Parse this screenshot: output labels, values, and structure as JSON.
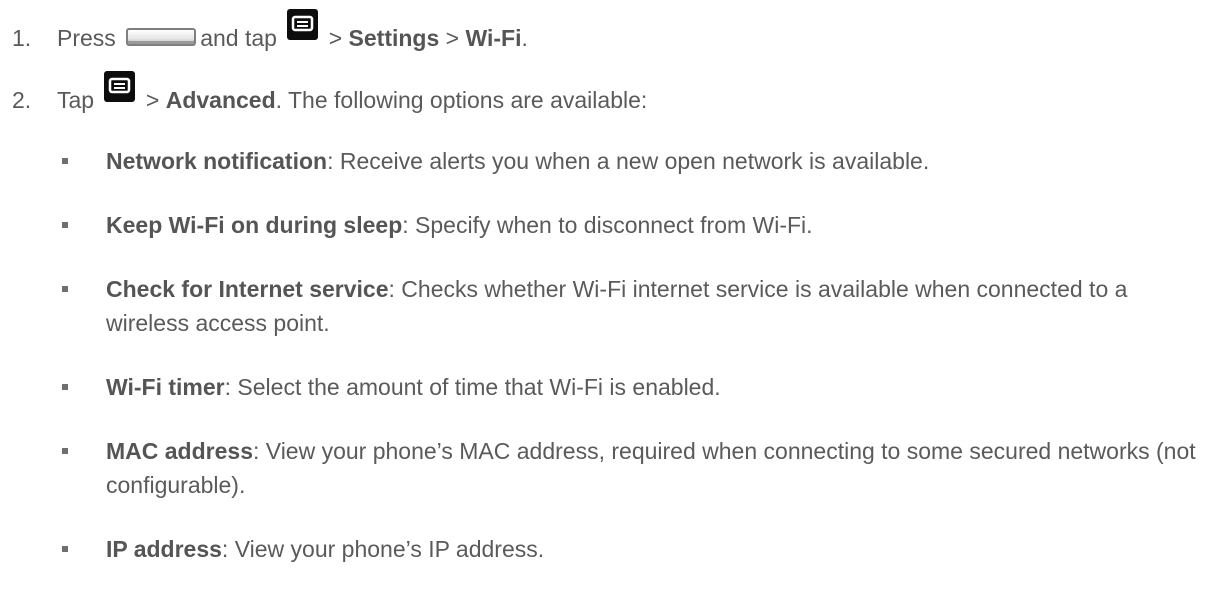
{
  "steps": [
    {
      "number": "1.",
      "prefix": "Press",
      "mid": "and tap",
      "sep1": ">",
      "item1": "Settings",
      "sep2": ">",
      "item2": "Wi-Fi",
      "end": "."
    },
    {
      "number": "2.",
      "prefix": "Tap",
      "sep1": ">",
      "item1": "Advanced",
      "rest": ". The following options are available:"
    }
  ],
  "options": [
    {
      "term": "Network notification",
      "desc": ": Receive alerts you when a new open network is available."
    },
    {
      "term": "Keep Wi-Fi on during sleep",
      "desc": ": Specify when to disconnect from Wi-Fi."
    },
    {
      "term": "Check for Internet service",
      "desc": ": Checks whether Wi-Fi internet service is available when connected to a wireless access point."
    },
    {
      "term": "Wi-Fi timer",
      "desc": ": Select the amount of time that Wi-Fi is enabled."
    },
    {
      "term": "MAC address",
      "desc": ": View your phone’s MAC address, required when connecting to some secured networks (not configurable)."
    },
    {
      "term": "IP address",
      "desc": ": View your phone’s IP address."
    }
  ],
  "icons": {
    "home_key": "home-key-icon",
    "menu_key": "menu-key-icon"
  }
}
